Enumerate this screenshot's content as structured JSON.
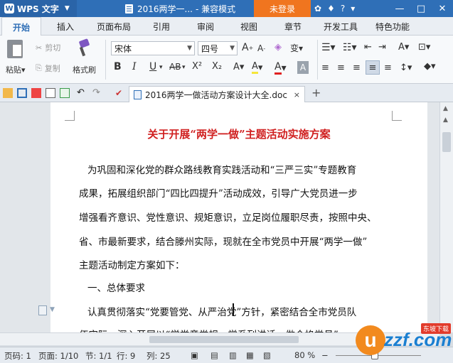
{
  "titlebar": {
    "app_name": "WPS 文字",
    "doc_title": "2016两学一...",
    "mode": "- 兼容模式",
    "login_label": "未登录",
    "help_label": "?"
  },
  "menu": {
    "tabs": [
      "开始",
      "插入",
      "页面布局",
      "引用",
      "审阅",
      "视图",
      "章节",
      "开发工具",
      "特色功能"
    ],
    "active": "开始"
  },
  "ribbon": {
    "paste": "粘贴",
    "cut": "剪切",
    "copy": "复制",
    "format_painter": "格式刷",
    "font_name": "宋体",
    "font_size": "四号",
    "bold": "B",
    "italic": "I",
    "underline": "U",
    "strike": "AB",
    "superscript": "X²",
    "subscript": "X₂",
    "font_color": "A",
    "highlight": "A"
  },
  "doc_tab": {
    "filename": "2016两学一做活动方案设计大全.doc",
    "close": "×",
    "add": "+"
  },
  "document": {
    "heading": "关于开展“两学一做”主题活动实施方案",
    "lines": [
      "为巩固和深化党的群众路线教育实践活动和“三严三实”专题教育",
      "成果，拓展组织部门“四比四提升”活动成效，引导广大党员进一步",
      "增强看齐意识、党性意识、规矩意识，立足岗位履职尽责，按照中央、",
      "省、市最新要求，结合滕州实际，现就在全市党员中开展“两学一做”",
      "主题活动制定方案如下：",
      "一、总体要求",
      "认真贯彻落实“党要管党、从严治党”方针，紧密结合全市党员队",
      "伍实际，深入开展以“学党章党规、学系列讲话，做合格党员”"
    ]
  },
  "status": {
    "page_no": "页码: 1",
    "pages": "页面: 1/10",
    "section": "节: 1/1",
    "row": "行: 9",
    "col": "列: 25",
    "zoom": "80 %"
  },
  "watermark": {
    "mark": "u",
    "text": "zzf.com",
    "badge": "东坡下载"
  },
  "colors": {
    "title_bar": "#2f6fb7",
    "login": "#f0751f",
    "heading": "#d02020"
  }
}
